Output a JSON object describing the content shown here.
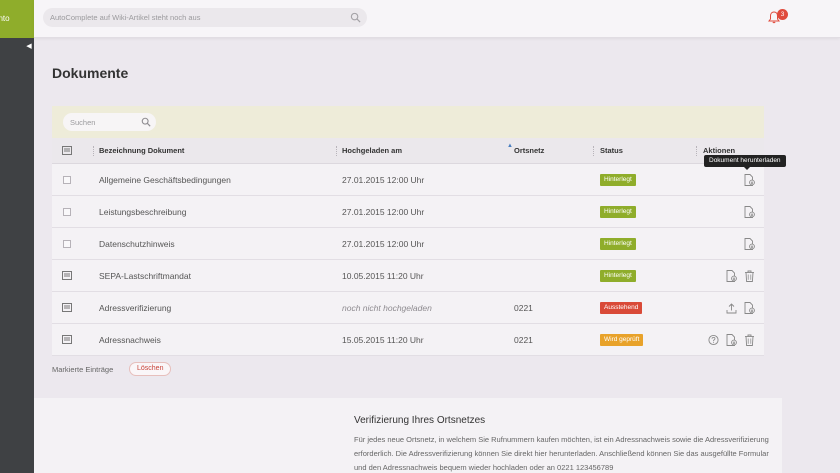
{
  "brand": "onto",
  "search": {
    "placeholder": "AutoComplete auf Wiki-Artikel steht noch aus"
  },
  "notifications": {
    "count": "3"
  },
  "page": {
    "title": "Dokumente"
  },
  "table": {
    "search_placeholder": "Suchen",
    "headers": {
      "name": "Bezeichnung Dokument",
      "uploaded": "Hochgeladen am",
      "network": "Ortsnetz",
      "status": "Status",
      "actions": "Aktionen"
    },
    "rows": [
      {
        "name": "Allgemeine Geschäftsbedingungen",
        "uploaded": "27.01.2015 12:00 Uhr",
        "network": "",
        "status": "Hinterlegt"
      },
      {
        "name": "Leistungsbeschreibung",
        "uploaded": "27.01.2015 12:00 Uhr",
        "network": "",
        "status": "Hinterlegt"
      },
      {
        "name": "Datenschutzhinweis",
        "uploaded": "27.01.2015 12:00 Uhr",
        "network": "",
        "status": "Hinterlegt"
      },
      {
        "name": "SEPA-Lastschriftmandat",
        "uploaded": "10.05.2015 11:20 Uhr",
        "network": "",
        "status": "Hinterlegt"
      },
      {
        "name": "Adressverifizierung",
        "uploaded": "noch nicht hochgeladen",
        "network": "0221",
        "status": "Ausstehend"
      },
      {
        "name": "Adressnachweis",
        "uploaded": "15.05.2015 11:20 Uhr",
        "network": "0221",
        "status": "Wird geprüft"
      }
    ],
    "tooltip": "Dokument herunterladen"
  },
  "footer": {
    "marked_label": "Markierte Einträge",
    "delete_label": "Löschen"
  },
  "info": {
    "title": "Verifizierung Ihres Ortsnetzes",
    "text": "Für jedes neue Ortsnetz, in welchem Sie Rufnummern kaufen möchten, ist ein Adressnachweis sowie die Adressverifizierung erforderlich. Die Adressverifizierung können Sie direkt hier herunterladen. Anschließend können Sie das ausgefüllte Formular und den Adressnachweis bequem wieder hochladen oder an 0221 123456789"
  },
  "colors": {
    "brand": "#8fad2b",
    "danger": "#d94a38",
    "warning": "#e8a22a",
    "rail": "#3f4144"
  }
}
